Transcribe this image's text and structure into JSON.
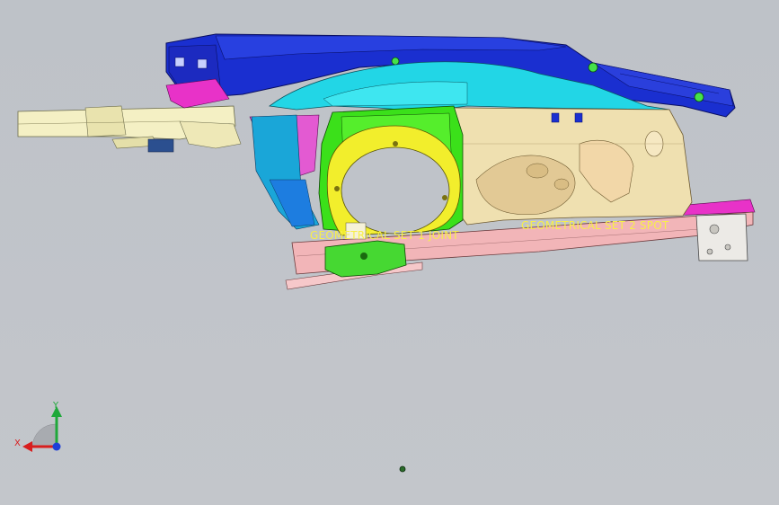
{
  "viewport": {
    "background": "#bfc3c9"
  },
  "annotations": {
    "label_left": "GEOMETRICAL SET 1 JOINT",
    "label_right": "GEOMETRICAL SET 2 SPOT",
    "color": "#f7ef4a"
  },
  "axis_triad": {
    "x_label": "X",
    "y_label": "Y",
    "x_color": "#d81e1e",
    "y_color": "#1fa83a",
    "z_color": "#1e3fd8"
  },
  "colors": {
    "blue_panel": "#1a2fd0",
    "cyan_panel": "#22d6e6",
    "green_panel": "#3be01a",
    "yellow_panel": "#f2ee2c",
    "tan_panel": "#efe0b0",
    "magenta_panel": "#e832c8",
    "pink_rail": "#f2b5b8",
    "cream_bracket": "#f4f0c4"
  }
}
